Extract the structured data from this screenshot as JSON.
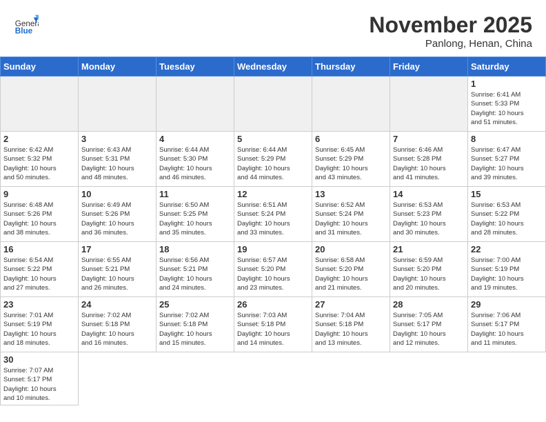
{
  "header": {
    "logo_general": "General",
    "logo_blue": "Blue",
    "month_title": "November 2025",
    "location": "Panlong, Henan, China"
  },
  "weekdays": [
    "Sunday",
    "Monday",
    "Tuesday",
    "Wednesday",
    "Thursday",
    "Friday",
    "Saturday"
  ],
  "days": [
    {
      "day": "",
      "info": ""
    },
    {
      "day": "",
      "info": ""
    },
    {
      "day": "",
      "info": ""
    },
    {
      "day": "",
      "info": ""
    },
    {
      "day": "",
      "info": ""
    },
    {
      "day": "",
      "info": ""
    },
    {
      "day": "1",
      "info": "Sunrise: 6:41 AM\nSunset: 5:33 PM\nDaylight: 10 hours\nand 51 minutes."
    },
    {
      "day": "2",
      "info": "Sunrise: 6:42 AM\nSunset: 5:32 PM\nDaylight: 10 hours\nand 50 minutes."
    },
    {
      "day": "3",
      "info": "Sunrise: 6:43 AM\nSunset: 5:31 PM\nDaylight: 10 hours\nand 48 minutes."
    },
    {
      "day": "4",
      "info": "Sunrise: 6:44 AM\nSunset: 5:30 PM\nDaylight: 10 hours\nand 46 minutes."
    },
    {
      "day": "5",
      "info": "Sunrise: 6:44 AM\nSunset: 5:29 PM\nDaylight: 10 hours\nand 44 minutes."
    },
    {
      "day": "6",
      "info": "Sunrise: 6:45 AM\nSunset: 5:29 PM\nDaylight: 10 hours\nand 43 minutes."
    },
    {
      "day": "7",
      "info": "Sunrise: 6:46 AM\nSunset: 5:28 PM\nDaylight: 10 hours\nand 41 minutes."
    },
    {
      "day": "8",
      "info": "Sunrise: 6:47 AM\nSunset: 5:27 PM\nDaylight: 10 hours\nand 39 minutes."
    },
    {
      "day": "9",
      "info": "Sunrise: 6:48 AM\nSunset: 5:26 PM\nDaylight: 10 hours\nand 38 minutes."
    },
    {
      "day": "10",
      "info": "Sunrise: 6:49 AM\nSunset: 5:26 PM\nDaylight: 10 hours\nand 36 minutes."
    },
    {
      "day": "11",
      "info": "Sunrise: 6:50 AM\nSunset: 5:25 PM\nDaylight: 10 hours\nand 35 minutes."
    },
    {
      "day": "12",
      "info": "Sunrise: 6:51 AM\nSunset: 5:24 PM\nDaylight: 10 hours\nand 33 minutes."
    },
    {
      "day": "13",
      "info": "Sunrise: 6:52 AM\nSunset: 5:24 PM\nDaylight: 10 hours\nand 31 minutes."
    },
    {
      "day": "14",
      "info": "Sunrise: 6:53 AM\nSunset: 5:23 PM\nDaylight: 10 hours\nand 30 minutes."
    },
    {
      "day": "15",
      "info": "Sunrise: 6:53 AM\nSunset: 5:22 PM\nDaylight: 10 hours\nand 28 minutes."
    },
    {
      "day": "16",
      "info": "Sunrise: 6:54 AM\nSunset: 5:22 PM\nDaylight: 10 hours\nand 27 minutes."
    },
    {
      "day": "17",
      "info": "Sunrise: 6:55 AM\nSunset: 5:21 PM\nDaylight: 10 hours\nand 26 minutes."
    },
    {
      "day": "18",
      "info": "Sunrise: 6:56 AM\nSunset: 5:21 PM\nDaylight: 10 hours\nand 24 minutes."
    },
    {
      "day": "19",
      "info": "Sunrise: 6:57 AM\nSunset: 5:20 PM\nDaylight: 10 hours\nand 23 minutes."
    },
    {
      "day": "20",
      "info": "Sunrise: 6:58 AM\nSunset: 5:20 PM\nDaylight: 10 hours\nand 21 minutes."
    },
    {
      "day": "21",
      "info": "Sunrise: 6:59 AM\nSunset: 5:20 PM\nDaylight: 10 hours\nand 20 minutes."
    },
    {
      "day": "22",
      "info": "Sunrise: 7:00 AM\nSunset: 5:19 PM\nDaylight: 10 hours\nand 19 minutes."
    },
    {
      "day": "23",
      "info": "Sunrise: 7:01 AM\nSunset: 5:19 PM\nDaylight: 10 hours\nand 18 minutes."
    },
    {
      "day": "24",
      "info": "Sunrise: 7:02 AM\nSunset: 5:18 PM\nDaylight: 10 hours\nand 16 minutes."
    },
    {
      "day": "25",
      "info": "Sunrise: 7:02 AM\nSunset: 5:18 PM\nDaylight: 10 hours\nand 15 minutes."
    },
    {
      "day": "26",
      "info": "Sunrise: 7:03 AM\nSunset: 5:18 PM\nDaylight: 10 hours\nand 14 minutes."
    },
    {
      "day": "27",
      "info": "Sunrise: 7:04 AM\nSunset: 5:18 PM\nDaylight: 10 hours\nand 13 minutes."
    },
    {
      "day": "28",
      "info": "Sunrise: 7:05 AM\nSunset: 5:17 PM\nDaylight: 10 hours\nand 12 minutes."
    },
    {
      "day": "29",
      "info": "Sunrise: 7:06 AM\nSunset: 5:17 PM\nDaylight: 10 hours\nand 11 minutes."
    },
    {
      "day": "30",
      "info": "Sunrise: 7:07 AM\nSunset: 5:17 PM\nDaylight: 10 hours\nand 10 minutes."
    }
  ]
}
